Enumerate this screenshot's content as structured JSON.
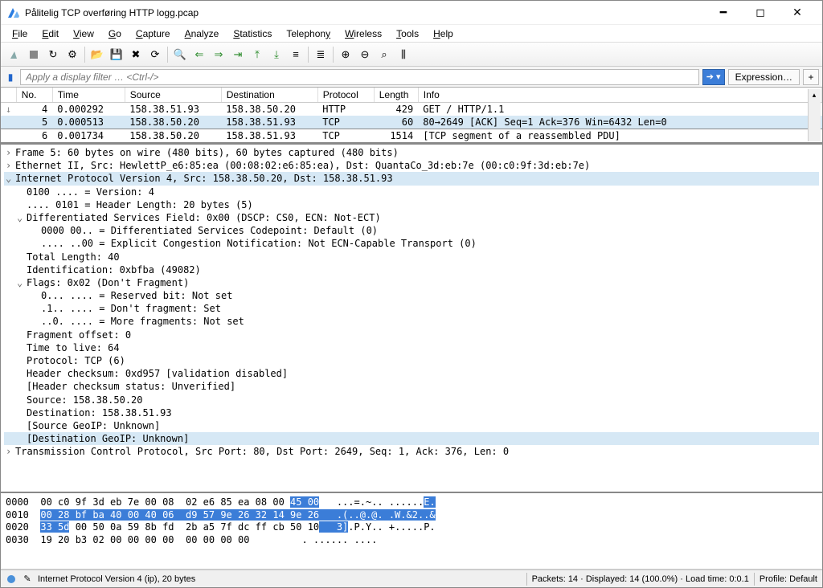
{
  "window": {
    "title": "Pålitelig TCP overføring HTTP logg.pcap"
  },
  "menu": {
    "file": "File",
    "edit": "Edit",
    "view": "View",
    "go": "Go",
    "capture": "Capture",
    "analyze": "Analyze",
    "statistics": "Statistics",
    "telephony": "Telephony",
    "wireless": "Wireless",
    "tools": "Tools",
    "help": "Help"
  },
  "filter": {
    "placeholder": "Apply a display filter … <Ctrl-/>",
    "expression_label": "Expression…",
    "plus": "+"
  },
  "columns": {
    "no": "No.",
    "time": "Time",
    "source": "Source",
    "destination": "Destination",
    "protocol": "Protocol",
    "length": "Length",
    "info": "Info"
  },
  "packets": [
    {
      "no": "4",
      "time": "0.000292",
      "src": "158.38.51.93",
      "dst": "158.38.50.20",
      "proto": "HTTP",
      "len": "429",
      "info": "GET / HTTP/1.1"
    },
    {
      "no": "5",
      "time": "0.000513",
      "src": "158.38.50.20",
      "dst": "158.38.51.93",
      "proto": "TCP",
      "len": "60",
      "info": "80→2649 [ACK] Seq=1 Ack=376 Win=6432 Len=0"
    },
    {
      "no": "6",
      "time": "0.001734",
      "src": "158.38.50.20",
      "dst": "158.38.51.93",
      "proto": "TCP",
      "len": "1514",
      "info": "[TCP segment of a reassembled PDU]"
    }
  ],
  "details": {
    "frame": "Frame 5: 60 bytes on wire (480 bits), 60 bytes captured (480 bits)",
    "eth": "Ethernet II, Src: HewlettP_e6:85:ea (00:08:02:e6:85:ea), Dst: QuantaCo_3d:eb:7e (00:c0:9f:3d:eb:7e)",
    "ip_header": "Internet Protocol Version 4, Src: 158.38.50.20, Dst: 158.38.51.93",
    "ip": {
      "version": "0100 .... = Version: 4",
      "hdrlen": ".... 0101 = Header Length: 20 bytes (5)",
      "dsf": "Differentiated Services Field: 0x00 (DSCP: CS0, ECN: Not-ECT)",
      "dscp": "0000 00.. = Differentiated Services Codepoint: Default (0)",
      "ecn": ".... ..00 = Explicit Congestion Notification: Not ECN-Capable Transport (0)",
      "totlen": "Total Length: 40",
      "ident": "Identification: 0xbfba (49082)",
      "flags": "Flags: 0x02 (Don't Fragment)",
      "flag_r": "0... .... = Reserved bit: Not set",
      "flag_df": ".1.. .... = Don't fragment: Set",
      "flag_mf": "..0. .... = More fragments: Not set",
      "fragoff": "Fragment offset: 0",
      "ttl": "Time to live: 64",
      "protocol": "Protocol: TCP (6)",
      "chksum": "Header checksum: 0xd957 [validation disabled]",
      "chkstat": "[Header checksum status: Unverified]",
      "src": "Source: 158.38.50.20",
      "dst": "Destination: 158.38.51.93",
      "geo_src": "[Source GeoIP: Unknown]",
      "geo_dst": "[Destination GeoIP: Unknown]"
    },
    "tcp": "Transmission Control Protocol, Src Port: 80, Dst Port: 2649, Seq: 1, Ack: 376, Len: 0"
  },
  "hex": {
    "l0_off": "0000",
    "l0_a": "00 c0 9f 3d eb 7e 00 08  02 e6 85 ea 08 00 ",
    "l0_hl": "45 00",
    "l0_asc_a": "   ...=.~.. ......",
    "l0_asc_hl": "E.",
    "l1_off": "0010",
    "l1_hl": "00 28 bf ba 40 00 40 06  d9 57 9e 26 32 14 9e 26",
    "l1_asc_hl": "   .(..@.@. .W.&2..&",
    "l2_off": "0020",
    "l2_hl": "33 5d",
    "l2_a": " 00 50 0a 59 8b fd  2b a5 7f dc ff cb 50 10",
    "l2_asc_hl": "   3]",
    "l2_asc_a": ".P.Y.. +.....P.",
    "l3_off": "0030",
    "l3_a": "19 20 b3 02 00 00 00 00  00 00 00 00",
    "l3_asc": "         . ...... ...."
  },
  "status": {
    "main": "Internet Protocol Version 4 (ip), 20 bytes",
    "packets": "Packets: 14 · Displayed: 14 (100.0%) · Load time: 0:0.1",
    "profile": "Profile: Default"
  }
}
